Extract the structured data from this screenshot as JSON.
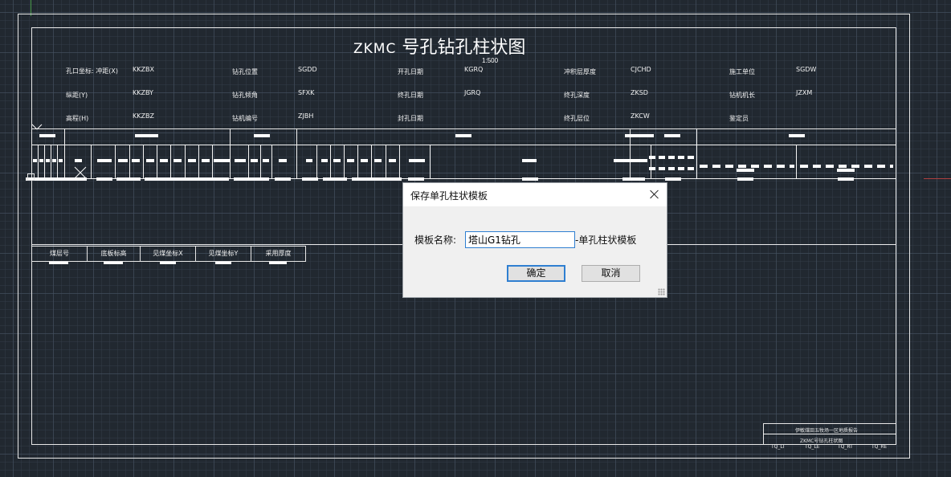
{
  "drawing": {
    "title_prefix": "ZKMC",
    "title_suffix": " 号孔钻孔柱状图",
    "scale": "1:500",
    "header_labels": [
      {
        "text": "孔口坐标: 冲距(X)",
        "field": "KKZBX"
      },
      {
        "text": "纵距(Y)",
        "field": "KKZBY"
      },
      {
        "text": "高程(H)",
        "field": "KKZBZ"
      },
      {
        "text": "钻孔位置",
        "field": "SGDD"
      },
      {
        "text": "钻孔倾角",
        "field": "SFXK"
      },
      {
        "text": "钻机编号",
        "field": "ZJBH"
      },
      {
        "text": "开孔日期",
        "field": "KGRQ"
      },
      {
        "text": "终孔日期",
        "field": "JGRQ"
      },
      {
        "text": "封孔日期",
        "field": ""
      },
      {
        "text": "冲积层厚度",
        "field": "CJCHD"
      },
      {
        "text": "终孔深度",
        "field": "ZKSD"
      },
      {
        "text": "终孔层位",
        "field": "ZKCW"
      },
      {
        "text": "施工单位",
        "field": "SGDW"
      },
      {
        "text": "钻机机长",
        "field": "JZXM"
      },
      {
        "text": "鉴定员",
        "field": ""
      }
    ],
    "legend_headers": [
      "煤层号",
      "底板标高",
      "见煤坐标X",
      "见煤坐标Y",
      "采用厚度"
    ],
    "title_block": {
      "line1": "伊敏煤田五牧场一区地质报告",
      "line2": "ZKMC号钻孔柱状图",
      "tags": [
        "TQ_LT",
        "TQ_LE",
        "TQ_RT",
        "TQ_RE"
      ]
    }
  },
  "dialog": {
    "title": "保存单孔柱状模板",
    "label": "模板名称:",
    "input_value": "塔山G1钻孔",
    "suffix": "-单孔柱状模板",
    "ok_label": "确定",
    "cancel_label": "取消"
  }
}
